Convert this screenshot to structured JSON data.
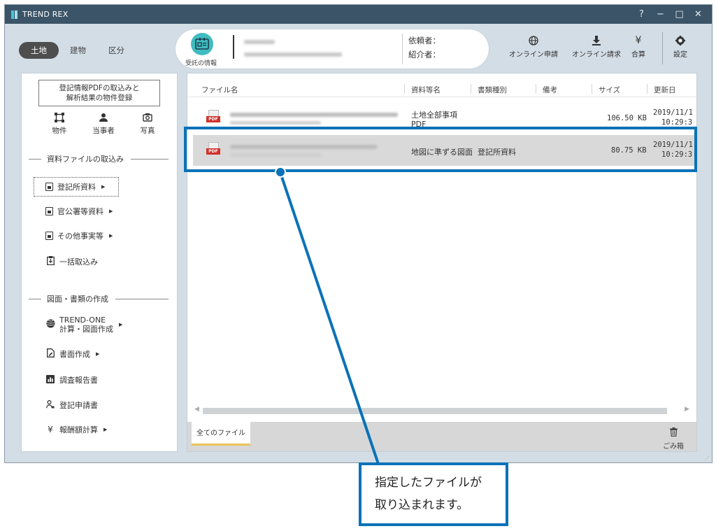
{
  "window": {
    "title": "TREND REX",
    "controls": [
      "?",
      "−",
      "□",
      "✕"
    ]
  },
  "toolbar": {
    "tabs": [
      {
        "label": "土地",
        "active": true
      },
      {
        "label": "建物",
        "active": false
      },
      {
        "label": "区分",
        "active": false
      }
    ],
    "info": {
      "icon_label": "受託の情報",
      "requester_label": "依頼者：",
      "introducer_label": "紹介者："
    },
    "buttons": [
      {
        "label": "オンライン申請",
        "icon": "globe-icon",
        "glyph": "🌐"
      },
      {
        "label": "オンライン請求",
        "icon": "download-icon",
        "glyph": "⬇"
      },
      {
        "label": "合算",
        "icon": "yen-icon",
        "glyph": "¥"
      },
      {
        "label": "設定",
        "icon": "gear-icon",
        "glyph": "⚙"
      }
    ]
  },
  "sidebar": {
    "register_button": "登記情報PDFの取込みと\n解析結果の物件登録",
    "register_line1": "登記情報PDFの取込みと",
    "register_line2": "解析結果の物件登録",
    "quick": [
      {
        "label": "物件",
        "icon": "property-icon",
        "glyph": "⌗"
      },
      {
        "label": "当事者",
        "icon": "person-icon",
        "glyph": "👤"
      },
      {
        "label": "写真",
        "icon": "camera-icon",
        "glyph": "📷"
      }
    ],
    "section1": "資料ファイルの取込み",
    "import_items": [
      {
        "label": "登記所資料",
        "arrow": "▶"
      },
      {
        "label": "官公署等資料",
        "arrow": "▶"
      },
      {
        "label": "その他事実等",
        "arrow": "▶"
      },
      {
        "label": "一括取込み",
        "arrow": ""
      }
    ],
    "section2": "図面・書類の作成",
    "create_items": [
      {
        "label1": "TREND-ONE",
        "label2": "計算・図面作成",
        "arrow": "▶"
      },
      {
        "label": "書面作成",
        "arrow": "▶"
      },
      {
        "label": "調査報告書",
        "arrow": ""
      },
      {
        "label": "登記申請書",
        "arrow": ""
      },
      {
        "label": "報酬額計算",
        "arrow": "▶"
      }
    ]
  },
  "files": {
    "columns": [
      "ファイル名",
      "資料等名",
      "書類種別",
      "備考",
      "サイズ",
      "更新日"
    ],
    "rows": [
      {
        "doc_name1": "土地全部事項",
        "doc_name2": "PDF",
        "type": "",
        "note": "",
        "size": "106.50 KB",
        "date": "2019/11/1",
        "time": "10:29:3"
      },
      {
        "doc_name1": "地図に準ずる図面",
        "doc_name2": "",
        "type": "登記所資料",
        "note": "",
        "size": "80.75 KB",
        "date": "2019/11/1",
        "time": "10:29:3"
      }
    ],
    "tab_all": "全てのファイル",
    "trash_label": "ごみ箱"
  },
  "callout": {
    "line1": "指定したファイルが",
    "line2": "取り込まれます。"
  },
  "colors": {
    "titlebar": "#3b5468",
    "accent_blue": "#0a72b8",
    "info_icon": "#3fbcc0",
    "pdf_red": "#d0322c"
  }
}
